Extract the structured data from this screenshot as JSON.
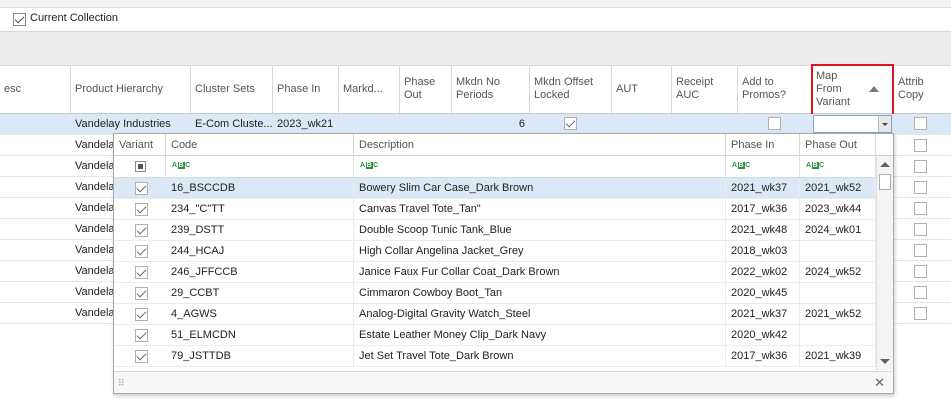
{
  "collection": {
    "label": "Current Collection",
    "checked": true
  },
  "grid": {
    "headers": {
      "desc": "esc",
      "product_hierarchy": "Product Hierarchy",
      "cluster_sets": "Cluster Sets",
      "phase_in": "Phase In",
      "markd": "Markd...",
      "phase_out": "Phase Out",
      "mkdn_no_periods": "Mkdn No Periods",
      "mkdn_offset_locked": "Mkdn Offset Locked",
      "aut": "AUT",
      "receipt_auc": "Receipt AUC",
      "add_to_promos": "Add to Promos?",
      "map_from_variant": "Map From Variant",
      "attrib_copy": "Attrib Copy"
    },
    "selected_row": {
      "product_hierarchy": "Vandelay Industries",
      "cluster_sets": "E-Com Cluste...",
      "phase_in": "2023_wk21",
      "mkdn_no_periods": "6"
    },
    "other_row_label": "Vandela"
  },
  "dropdown": {
    "headers": {
      "variant": "Variant",
      "code": "Code",
      "description": "Description",
      "phase_in": "Phase In",
      "phase_out": "Phase Out"
    },
    "rows": [
      {
        "code": "16_BSCCDB",
        "description": "Bowery Slim Car Case_Dark Brown",
        "phase_in": "2021_wk37",
        "phase_out": "2021_wk52"
      },
      {
        "code": "234_\"C\"TT",
        "description": "Canvas Travel Tote_Tan\"",
        "phase_in": "2017_wk36",
        "phase_out": "2023_wk44"
      },
      {
        "code": "239_DSTT",
        "description": "Double Scoop Tunic Tank_Blue",
        "phase_in": "2021_wk48",
        "phase_out": "2024_wk01"
      },
      {
        "code": "244_HCAJ",
        "description": "High Collar Angelina Jacket_Grey",
        "phase_in": "2018_wk03",
        "phase_out": ""
      },
      {
        "code": "246_JFFCCB",
        "description": "Janice Faux Fur Collar Coat_Dark Brown",
        "phase_in": "2022_wk02",
        "phase_out": "2024_wk52"
      },
      {
        "code": "29_CCBT",
        "description": "Cimmaron Cowboy Boot_Tan",
        "phase_in": "2020_wk45",
        "phase_out": ""
      },
      {
        "code": "4_AGWS",
        "description": "Analog-Digital Gravity Watch_Steel",
        "phase_in": "2021_wk37",
        "phase_out": "2021_wk52"
      },
      {
        "code": "51_ELMCDN",
        "description": "Estate Leather Money Clip_Dark Navy",
        "phase_in": "2020_wk42",
        "phase_out": ""
      },
      {
        "code": "79_JSTTDB",
        "description": "Jet Set Travel Tote_Dark Brown",
        "phase_in": "2017_wk36",
        "phase_out": "2021_wk39"
      }
    ]
  },
  "icons": {
    "filter": "abc-filter-icon",
    "close": "close-icon",
    "grip": "resize-grip-icon"
  },
  "colors": {
    "selection": "#dbe9f7",
    "highlight_box": "#e0141e",
    "filter_icon": "#2f8f3e"
  }
}
